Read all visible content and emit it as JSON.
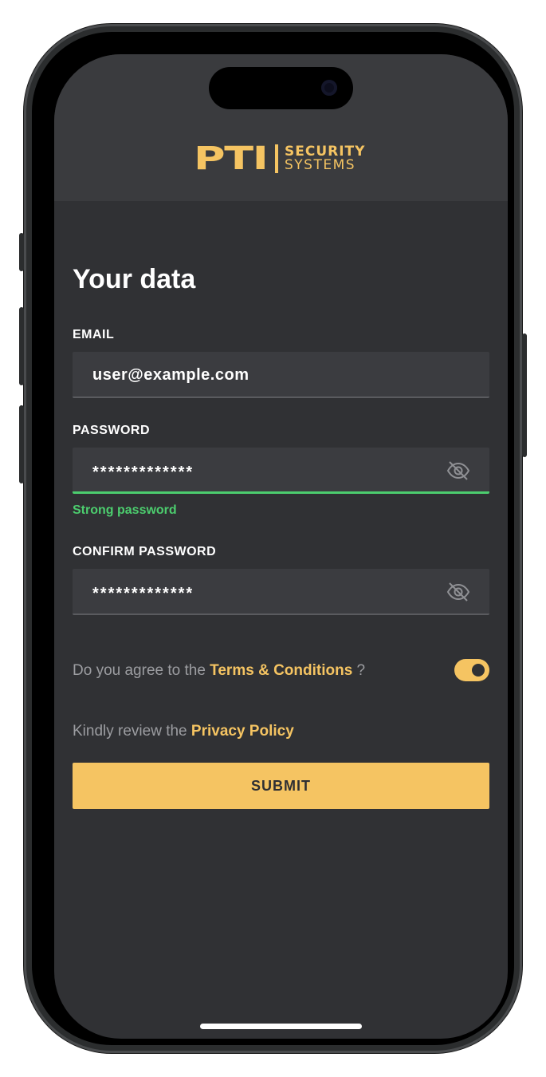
{
  "brand": {
    "mark": "PTI",
    "line1": "SECURITY",
    "line2": "SYSTEMS",
    "accent_color": "#f5c462"
  },
  "page": {
    "title": "Your data"
  },
  "form": {
    "email": {
      "label": "EMAIL",
      "value": "user@example.com"
    },
    "password": {
      "label": "PASSWORD",
      "value": "*************",
      "toggle_icon": "eye-off-icon",
      "hint": "Strong password",
      "hint_color": "#4ccd6e"
    },
    "confirm_password": {
      "label": "CONFIRM PASSWORD",
      "value": "*************",
      "toggle_icon": "eye-off-icon"
    },
    "terms": {
      "prefix": "Do you agree to the ",
      "link": "Terms & Conditions",
      "suffix": " ?",
      "checked": true
    },
    "privacy": {
      "prefix": "Kindly review the ",
      "link": "Privacy Policy"
    },
    "submit_label": "SUBMIT"
  },
  "colors": {
    "background": "#303134",
    "header": "#3a3b3e",
    "field": "#3b3c40",
    "muted_text": "#9c9da1"
  }
}
